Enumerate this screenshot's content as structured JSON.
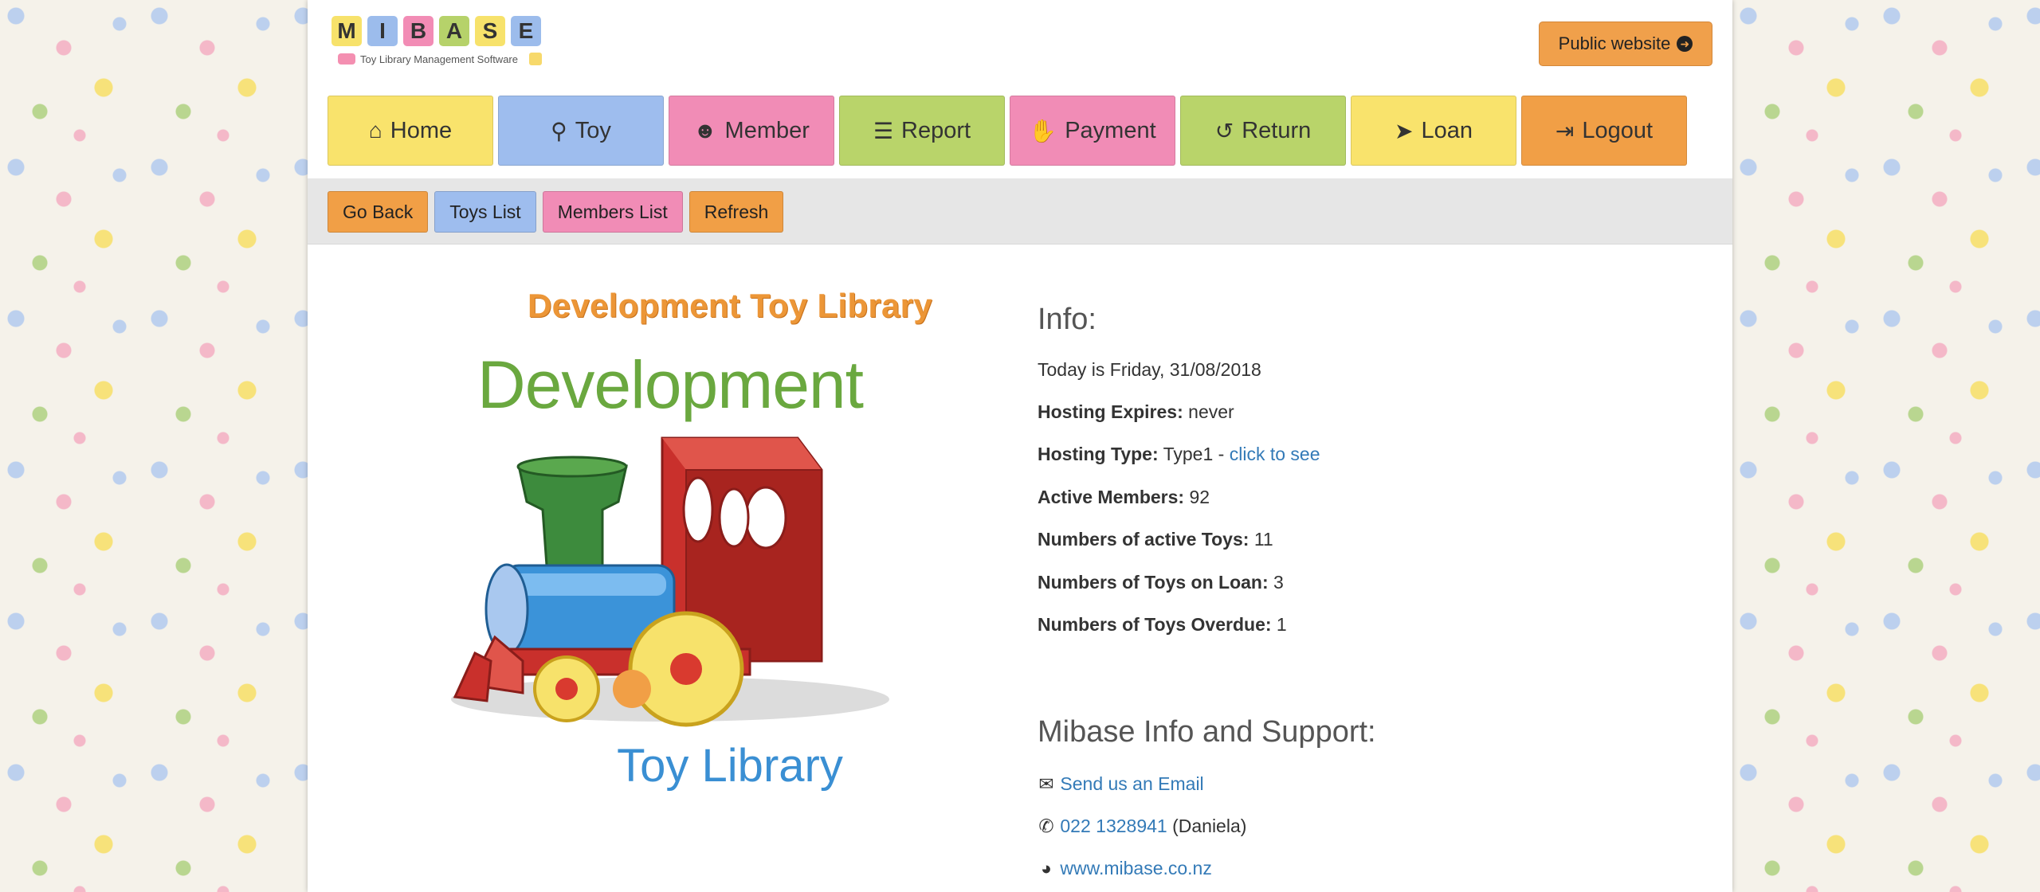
{
  "logo": {
    "letters": [
      {
        "char": "M",
        "color": "#f7e26b"
      },
      {
        "char": "I",
        "color": "#9cbcec"
      },
      {
        "char": "B",
        "color": "#f28cb5"
      },
      {
        "char": "A",
        "color": "#b6d26a"
      },
      {
        "char": "S",
        "color": "#f7e26b"
      },
      {
        "char": "E",
        "color": "#9cbcec"
      }
    ],
    "subtitle": "Toy Library Management Software"
  },
  "header": {
    "public_website_label": "Public website"
  },
  "nav": [
    {
      "label": "Home",
      "icon": "home-icon",
      "color": "#f9e36c"
    },
    {
      "label": "Toy",
      "icon": "bicycle-icon",
      "color": "#9ebdee"
    },
    {
      "label": "Member",
      "icon": "users-icon",
      "color": "#f18cb6"
    },
    {
      "label": "Report",
      "icon": "list-icon",
      "color": "#b9d46a"
    },
    {
      "label": "Payment",
      "icon": "hand-money-icon",
      "color": "#f18cb6"
    },
    {
      "label": "Return",
      "icon": "undo-icon",
      "color": "#b9d46a"
    },
    {
      "label": "Loan",
      "icon": "paper-plane-icon",
      "color": "#f9e36c"
    },
    {
      "label": "Logout",
      "icon": "sign-out-icon",
      "color": "#f19f46"
    }
  ],
  "subnav": [
    {
      "label": "Go Back",
      "color": "#f19f46"
    },
    {
      "label": "Toys List",
      "color": "#9ebdee"
    },
    {
      "label": "Members List",
      "color": "#f18cb6"
    },
    {
      "label": "Refresh",
      "color": "#f19f46"
    }
  ],
  "library": {
    "title": "Development Toy Library",
    "word_top": "Development",
    "word_bottom": "Toy Library"
  },
  "info": {
    "heading": "Info:",
    "today": "Today is Friday, 31/08/2018",
    "hosting_expires_label": "Hosting Expires:",
    "hosting_expires_value": "never",
    "hosting_type_label": "Hosting Type:",
    "hosting_type_value": "Type1 -",
    "hosting_type_link": "click to see",
    "active_members_label": "Active Members:",
    "active_members_value": "92",
    "active_toys_label": "Numbers of active Toys:",
    "active_toys_value": "11",
    "toys_on_loan_label": "Numbers of Toys on Loan:",
    "toys_on_loan_value": "3",
    "toys_overdue_label": "Numbers of Toys Overdue:",
    "toys_overdue_value": "1"
  },
  "support": {
    "heading": "Mibase Info and Support:",
    "email_link": "Send us an Email",
    "phone_link": "022 1328941",
    "phone_name": "(Daniela)",
    "website_link": "www.mibase.co.nz"
  }
}
